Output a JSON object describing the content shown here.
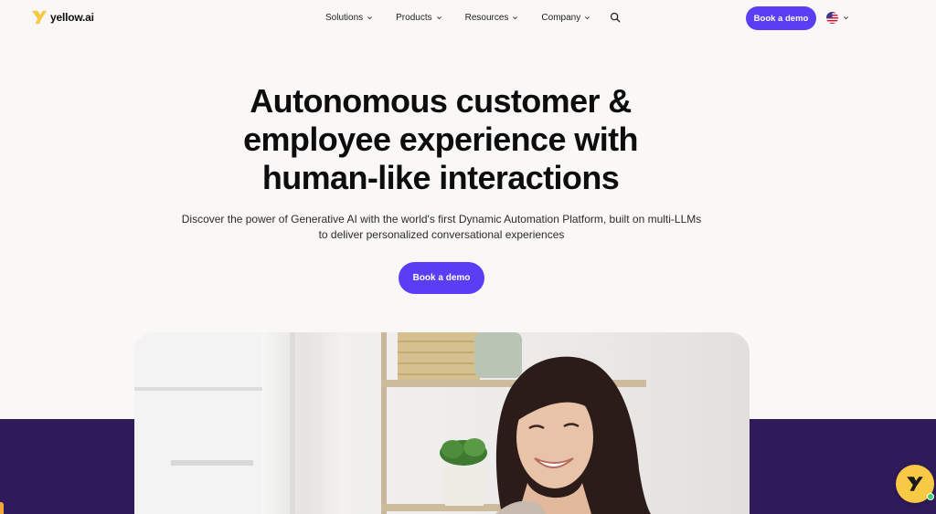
{
  "brand": {
    "name": "yellow.ai",
    "accent": "#5a3df5",
    "logo_color": "#f7c944",
    "band_color": "#2f1a5a"
  },
  "nav": {
    "items": [
      {
        "label": "Solutions",
        "icon": "chevron-down-icon"
      },
      {
        "label": "Products",
        "icon": "chevron-down-icon"
      },
      {
        "label": "Resources",
        "icon": "chevron-down-icon"
      },
      {
        "label": "Company",
        "icon": "chevron-down-icon"
      }
    ],
    "search_icon": "search-icon",
    "cta_label": "Book a demo",
    "language_icon": "us-flag-icon"
  },
  "hero": {
    "title_line1": "Autonomous customer &",
    "title_line2": "employee experience with",
    "title_line3": "human-like interactions",
    "subtitle": "Discover the power of Generative AI with the world's first Dynamic Automation Platform, built on multi-LLMs to deliver personalized conversational experiences",
    "cta_label": "Book a demo"
  },
  "media": {
    "image": "woman-smiling-at-laptop-photo"
  },
  "chat_widget": {
    "icon": "yellow-ai-chat-icon",
    "status": "online"
  }
}
